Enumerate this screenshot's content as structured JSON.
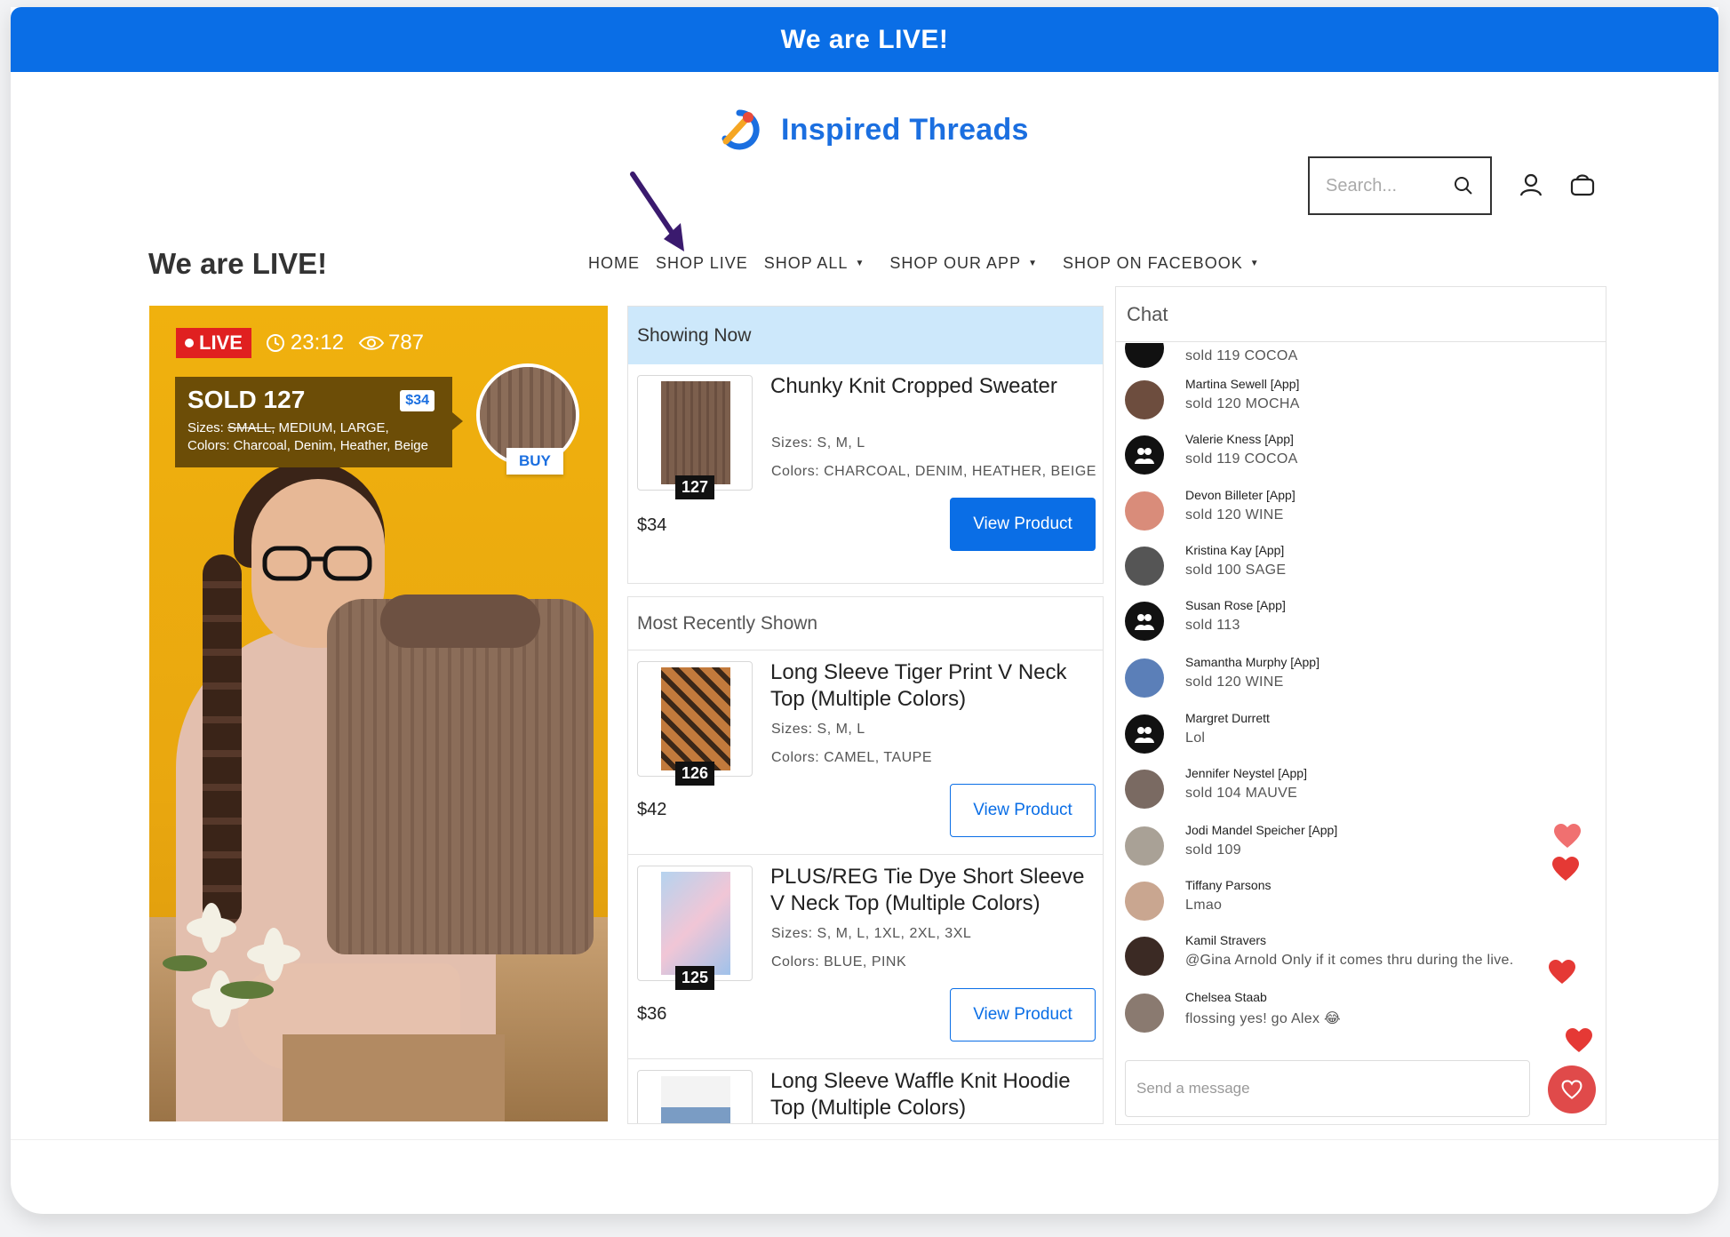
{
  "banner": {
    "text": "We are LIVE!"
  },
  "brand": {
    "name": "Inspired Threads"
  },
  "search": {
    "placeholder": "Search..."
  },
  "nav": [
    {
      "label": "HOME",
      "has_dropdown": false
    },
    {
      "label": "SHOP LIVE",
      "has_dropdown": false
    },
    {
      "label": "SHOP ALL",
      "has_dropdown": true
    },
    {
      "label": "SHOP OUR APP",
      "has_dropdown": true
    },
    {
      "label": "SHOP ON FACEBOOK",
      "has_dropdown": true
    }
  ],
  "page_title": "We are LIVE!",
  "video": {
    "live_label": "LIVE",
    "timer": "23:12",
    "viewers": "787",
    "sold_title": "SOLD 127",
    "price": "$34",
    "sizes_prefix": "Sizes: ",
    "sizes_struck": "SMALL,",
    "sizes_rest": " MEDIUM, LARGE,",
    "colors_line": "Colors: Charcoal, Denim, Heather, Beige",
    "buy_label": "BUY"
  },
  "showing_now": {
    "heading": "Showing Now",
    "product": {
      "title": "Chunky Knit Cropped Sweater",
      "badge": "127",
      "sizes": "Sizes: S, M, L",
      "colors": "Colors: CHARCOAL, DENIM, HEATHER, BEIGE",
      "price": "$34",
      "button": "View Product"
    }
  },
  "recent": {
    "heading": "Most Recently Shown",
    "items": [
      {
        "title": "Long Sleeve Tiger Print V Neck Top (Multiple Colors)",
        "badge": "126",
        "sizes": "Sizes: S, M, L",
        "colors": "Colors: CAMEL, TAUPE",
        "price": "$42",
        "button": "View Product"
      },
      {
        "title": "PLUS/REG Tie Dye Short Sleeve V Neck Top (Multiple Colors)",
        "badge": "125",
        "sizes": "Sizes: S, M, L, 1XL, 2XL, 3XL",
        "colors": "Colors: BLUE, PINK",
        "price": "$36",
        "button": "View Product"
      },
      {
        "title": "Long Sleeve Waffle Knit Hoodie Top (Multiple Colors)"
      }
    ]
  },
  "chat": {
    "heading": "Chat",
    "first_partial": "sold 119 COCOA",
    "messages": [
      {
        "name": "Martina Sewell [App]",
        "text": "sold 120 MOCHA",
        "avatar": "photo"
      },
      {
        "name": "Valerie Kness [App]",
        "text": "sold 119 COCOA",
        "avatar": "generic"
      },
      {
        "name": "Devon Billeter [App]",
        "text": "sold 120 WINE",
        "avatar": "photo"
      },
      {
        "name": "Kristina Kay [App]",
        "text": "sold 100 SAGE",
        "avatar": "photo"
      },
      {
        "name": "Susan Rose [App]",
        "text": "sold 113",
        "avatar": "generic"
      },
      {
        "name": "Samantha Murphy [App]",
        "text": "sold 120 WINE",
        "avatar": "photo"
      },
      {
        "name": "Margret Durrett",
        "text": "Lol",
        "avatar": "generic"
      },
      {
        "name": "Jennifer Neystel [App]",
        "text": "sold 104 MAUVE",
        "avatar": "photo"
      },
      {
        "name": "Jodi Mandel Speicher [App]",
        "text": "sold 109",
        "avatar": "photo"
      },
      {
        "name": "Tiffany Parsons",
        "text": "Lmao",
        "avatar": "photo"
      },
      {
        "name": "Kamil Stravers",
        "text": "@Gina Arnold Only if it comes thru during the live.",
        "avatar": "photo"
      },
      {
        "name": "Chelsea Staab",
        "text": "flossing yes! go Alex 😂",
        "avatar": "photo"
      }
    ],
    "send_placeholder": "Send a message"
  },
  "colors": {
    "primary": "#0a6ee6",
    "live_red": "#e02020",
    "heart": "#e53935",
    "showing_bg": "#cde8fb"
  }
}
